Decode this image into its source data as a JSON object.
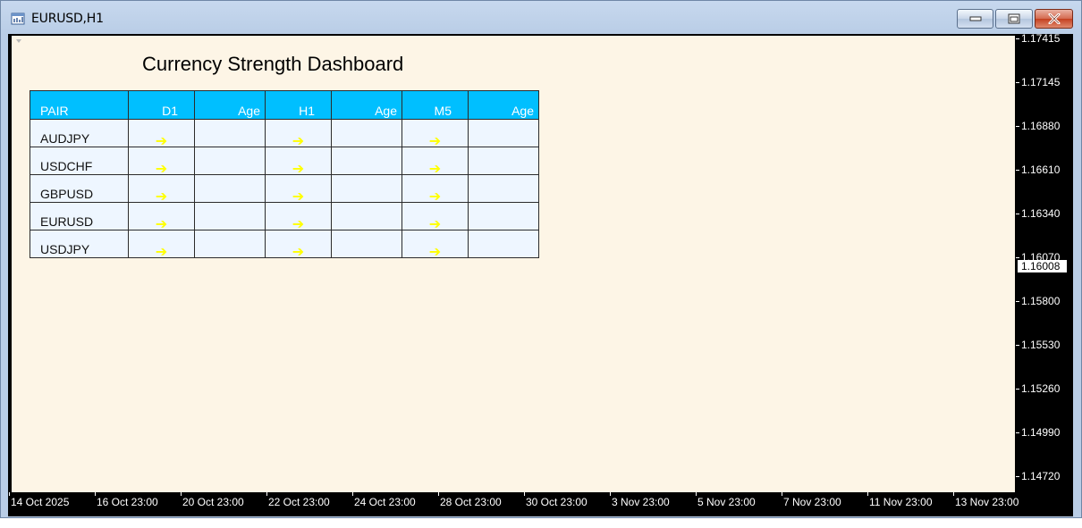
{
  "window": {
    "title": "EURUSD,H1"
  },
  "chart": {
    "background": "#fdf5e6",
    "price_axis": [
      "1.17415",
      "1.17145",
      "1.16880",
      "1.16610",
      "1.16340",
      "1.16070",
      "1.15800",
      "1.15530",
      "1.15260",
      "1.14990",
      "1.14720"
    ],
    "current_price": "1.16008",
    "time_axis": [
      "14 Oct 2025",
      "16 Oct 23:00",
      "20 Oct 23:00",
      "22 Oct 23:00",
      "24 Oct 23:00",
      "28 Oct 23:00",
      "30 Oct 23:00",
      "3 Nov 23:00",
      "5 Nov 23:00",
      "7 Nov 23:00",
      "11 Nov 23:00",
      "13 Nov 23:00"
    ]
  },
  "dashboard": {
    "title": "Currency Strength Dashboard",
    "header_color": "#00bfff",
    "arrow_color": "#ffff00",
    "columns": [
      "PAIR",
      "D1",
      "Age",
      "H1",
      "Age",
      "M5",
      "Age"
    ],
    "rows": [
      {
        "pair": "AUDJPY",
        "d1": "➔",
        "d1_age": "",
        "h1": "➔",
        "h1_age": "",
        "m5": "➔",
        "m5_age": ""
      },
      {
        "pair": "USDCHF",
        "d1": "➔",
        "d1_age": "",
        "h1": "➔",
        "h1_age": "",
        "m5": "➔",
        "m5_age": ""
      },
      {
        "pair": "GBPUSD",
        "d1": "➔",
        "d1_age": "",
        "h1": "➔",
        "h1_age": "",
        "m5": "➔",
        "m5_age": ""
      },
      {
        "pair": "EURUSD",
        "d1": "➔",
        "d1_age": "",
        "h1": "➔",
        "h1_age": "",
        "m5": "➔",
        "m5_age": ""
      },
      {
        "pair": "USDJPY",
        "d1": "➔",
        "d1_age": "",
        "h1": "➔",
        "h1_age": "",
        "m5": "➔",
        "m5_age": ""
      }
    ],
    "arrow_icon": "right-arrow-icon"
  }
}
